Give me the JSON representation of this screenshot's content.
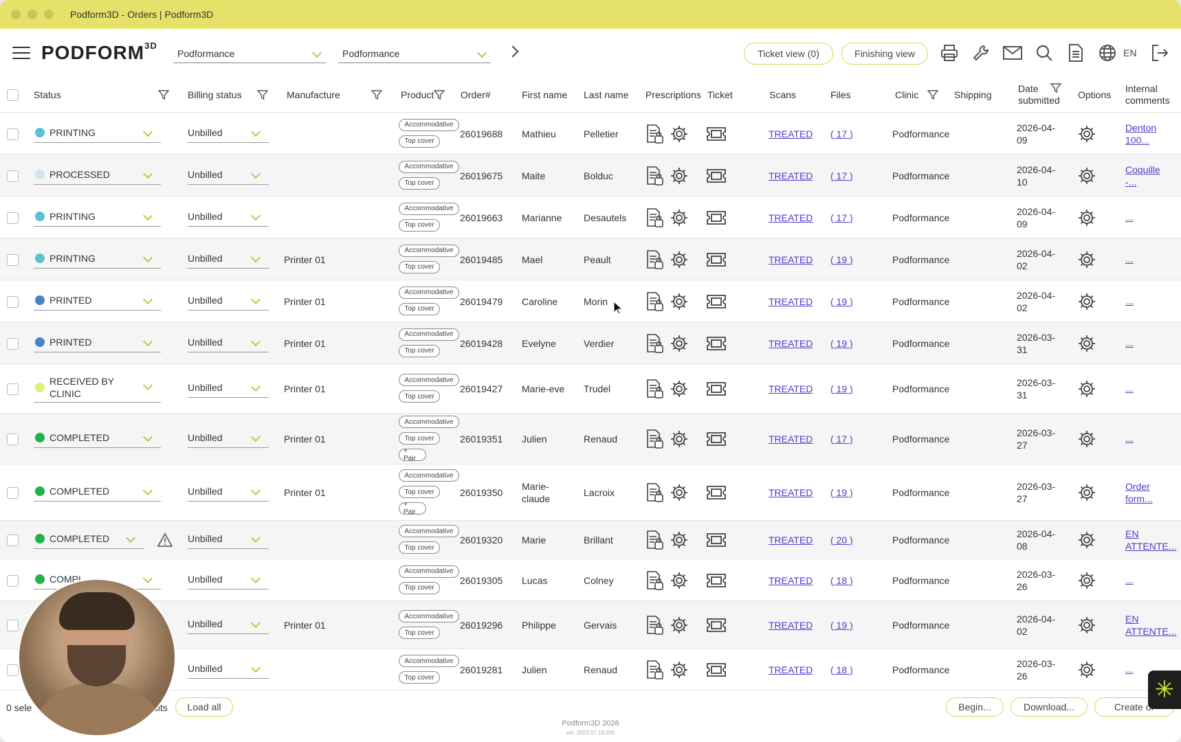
{
  "window": {
    "title": "Podform3D - Orders | Podform3D"
  },
  "header": {
    "logo": "PODFORM",
    "logo_sup": "3D",
    "select1": "Podformance",
    "select2": "Podformance",
    "ticket_view": "Ticket view (0)",
    "finishing_view": "Finishing view",
    "lang": "EN",
    "icons": [
      "printer-icon",
      "wrench-icon",
      "mail-icon",
      "search-icon",
      "document-icon",
      "globe-icon",
      "logout-icon"
    ]
  },
  "columns": {
    "status": "Status",
    "billing": "Billing status",
    "manufacture": "Manufacture",
    "product": "Product",
    "order": "Order#",
    "first": "First name",
    "last": "Last name",
    "prescriptions": "Prescriptions",
    "ticket": "Ticket",
    "scans": "Scans",
    "files": "Files",
    "clinic": "Clinic",
    "shipping": "Shipping",
    "date1": "Date",
    "date2": "submitted",
    "options": "Options",
    "comments1": "Internal",
    "comments2": "comments"
  },
  "colors": {
    "printing": "#5bc0d0",
    "processed": "#cfe6ef",
    "printed": "#4a82c8",
    "received": "#d9f07a",
    "completed": "#22b14c",
    "accent": "#d8d65a",
    "link": "#4a3fc7"
  },
  "rows": [
    {
      "status": "PRINTING",
      "status2": "",
      "dot": "printing",
      "billing": "Unbilled",
      "manufacture": "",
      "tags": [
        "Accommodative",
        "Top cover"
      ],
      "order": "26019688",
      "first": "Mathieu",
      "first2": "",
      "last": "Pelletier",
      "scans": "TREATED",
      "files": "( 17 )",
      "clinic": "Podformance",
      "date1": "2026-04-",
      "date2": "09",
      "comment1": "Denton",
      "comment2": "100..."
    },
    {
      "status": "PROCESSED",
      "status2": "",
      "dot": "processed",
      "billing": "Unbilled",
      "manufacture": "",
      "tags": [
        "Accommodative",
        "Top cover"
      ],
      "order": "26019675",
      "first": "Maite",
      "first2": "",
      "last": "Bolduc",
      "scans": "TREATED",
      "files": "( 17 )",
      "clinic": "Podformance",
      "date1": "2026-04-",
      "date2": "10",
      "comment1": "Coquille",
      "comment2": "-..."
    },
    {
      "status": "PRINTING",
      "status2": "",
      "dot": "printing",
      "billing": "Unbilled",
      "manufacture": "",
      "tags": [
        "Accommodative",
        "Top cover"
      ],
      "order": "26019663",
      "first": "Marianne",
      "first2": "",
      "last": "Desautels",
      "scans": "TREATED",
      "files": "( 17 )",
      "clinic": "Podformance",
      "date1": "2026-04-",
      "date2": "09",
      "comment1": "...",
      "comment2": ""
    },
    {
      "status": "PRINTING",
      "status2": "",
      "dot": "printing",
      "billing": "Unbilled",
      "manufacture": "Printer 01",
      "tags": [
        "Accommodative",
        "Top cover"
      ],
      "order": "26019485",
      "first": "Mael",
      "first2": "",
      "last": "Peault",
      "scans": "TREATED",
      "files": "( 19 )",
      "clinic": "Podformance",
      "date1": "2026-04-",
      "date2": "02",
      "comment1": "...",
      "comment2": ""
    },
    {
      "status": "PRINTED",
      "status2": "",
      "dot": "printed",
      "billing": "Unbilled",
      "manufacture": "Printer 01",
      "tags": [
        "Accommodative",
        "Top cover"
      ],
      "order": "26019479",
      "first": "Caroline",
      "first2": "",
      "last": "Morin",
      "scans": "TREATED",
      "files": "( 19 )",
      "clinic": "Podformance",
      "date1": "2026-04-",
      "date2": "02",
      "comment1": "...",
      "comment2": ""
    },
    {
      "status": "PRINTED",
      "status2": "",
      "dot": "printed",
      "billing": "Unbilled",
      "manufacture": "Printer 01",
      "tags": [
        "Accommodative",
        "Top cover"
      ],
      "order": "26019428",
      "first": "Evelyne",
      "first2": "",
      "last": "Verdier",
      "scans": "TREATED",
      "files": "( 19 )",
      "clinic": "Podformance",
      "date1": "2026-03-",
      "date2": "31",
      "comment1": "...",
      "comment2": ""
    },
    {
      "status": "RECEIVED BY",
      "status2": "CLINIC",
      "dot": "received",
      "billing": "Unbilled",
      "manufacture": "Printer 01",
      "tags": [
        "Accommodative",
        "Top cover"
      ],
      "order": "26019427",
      "first": "Marie-eve",
      "first2": "",
      "last": "Trudel",
      "scans": "TREATED",
      "files": "( 19 )",
      "clinic": "Podformance",
      "date1": "2026-03-",
      "date2": "31",
      "comment1": "...",
      "comment2": ""
    },
    {
      "status": "COMPLETED",
      "status2": "",
      "dot": "completed",
      "billing": "Unbilled",
      "manufacture": "Printer 01",
      "tags": [
        "Accommodative",
        "Top cover",
        "+ Pair"
      ],
      "order": "26019351",
      "first": "Julien",
      "first2": "",
      "last": "Renaud",
      "scans": "TREATED",
      "files": "( 17 )",
      "clinic": "Podformance",
      "date1": "2026-03-",
      "date2": "27",
      "comment1": "...",
      "comment2": ""
    },
    {
      "status": "COMPLETED",
      "status2": "",
      "dot": "completed",
      "billing": "Unbilled",
      "manufacture": "Printer 01",
      "tags": [
        "Accommodative",
        "Top cover",
        "+ Pair"
      ],
      "order": "26019350",
      "first": "Marie-",
      "first2": "claude",
      "last": "Lacroix",
      "scans": "TREATED",
      "files": "( 19 )",
      "clinic": "Podformance",
      "date1": "2026-03-",
      "date2": "27",
      "comment1": "Order",
      "comment2": "form..."
    },
    {
      "status": "COMPLETED",
      "status2": "",
      "dot": "completed",
      "billing": "Unbilled",
      "manufacture": "",
      "tags": [
        "Accommodative",
        "Top cover"
      ],
      "order": "26019320",
      "first": "Marie",
      "first2": "",
      "last": "Brillant",
      "scans": "TREATED",
      "files": "( 20 )",
      "clinic": "Podformance",
      "date1": "2026-04-",
      "date2": "08",
      "comment1": "EN",
      "comment2": "ATTENTE..."
    },
    {
      "status": "COMPL",
      "status2": "",
      "dot": "completed",
      "billing": "Unbilled",
      "manufacture": "",
      "tags": [
        "Accommodative",
        "Top cover"
      ],
      "order": "26019305",
      "first": "Lucas",
      "first2": "",
      "last": "Colney",
      "scans": "TREATED",
      "files": "( 18 )",
      "clinic": "Podformance",
      "date1": "2026-03-",
      "date2": "26",
      "comment1": "...",
      "comment2": ""
    },
    {
      "status": "",
      "status2": "",
      "dot": "",
      "billing": "Unbilled",
      "manufacture": "Printer 01",
      "tags": [
        "Accommodative",
        "Top cover"
      ],
      "order": "26019296",
      "first": "Philippe",
      "first2": "",
      "last": "Gervais",
      "scans": "TREATED",
      "files": "( 19 )",
      "clinic": "Podformance",
      "date1": "2026-04-",
      "date2": "02",
      "comment1": "EN",
      "comment2": "ATTENTE..."
    },
    {
      "status": "",
      "status2": "",
      "dot": "",
      "billing": "Unbilled",
      "manufacture": "",
      "tags": [
        "Accommodative",
        "Top cover"
      ],
      "order": "26019281",
      "first": "Julien",
      "first2": "",
      "last": "Renaud",
      "scans": "TREATED",
      "files": "( 18 )",
      "clinic": "Podformance",
      "date1": "2026-03-",
      "date2": "26",
      "comment1": "...",
      "comment2": ""
    }
  ],
  "footer": {
    "selected": "0 sele",
    "results": "ults",
    "load_all": "Load all",
    "begin": "Begin...",
    "download": "Download...",
    "create": "Create or",
    "copyright": "Podform3D 2026",
    "version": "ver. 2023.07.19.000"
  }
}
